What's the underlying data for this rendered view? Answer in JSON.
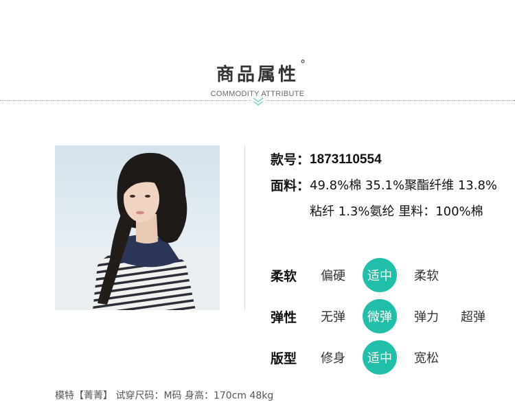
{
  "header": {
    "title": "商品属性",
    "degree": "°",
    "subtitle": "COMMODITY ATTRIBUTE"
  },
  "details": {
    "style_label": "款号：",
    "style_value": "1873110554",
    "fabric_label": "面料：",
    "fabric_value": "49.8%棉 35.1%聚酯纤维 13.8%粘纤 1.3%氨纶 里料：100%棉"
  },
  "attributes": [
    {
      "name": "柔软",
      "options": [
        "偏硬",
        "适中",
        "柔软"
      ],
      "selected": "适中"
    },
    {
      "name": "弹性",
      "options": [
        "无弹",
        "微弹",
        "弹力",
        "超弹"
      ],
      "selected": "微弹"
    },
    {
      "name": "版型",
      "options": [
        "修身",
        "适中",
        "宽松"
      ],
      "selected": "适中"
    }
  ],
  "footer": {
    "model_info": "模特【菁菁】 试穿尺码：M码 身高：170cm 48kg"
  },
  "colors": {
    "accent": "#21bfa9",
    "chevron": "#7fd3c9"
  },
  "icons": {
    "chevron": "double-chevron-down-icon"
  }
}
